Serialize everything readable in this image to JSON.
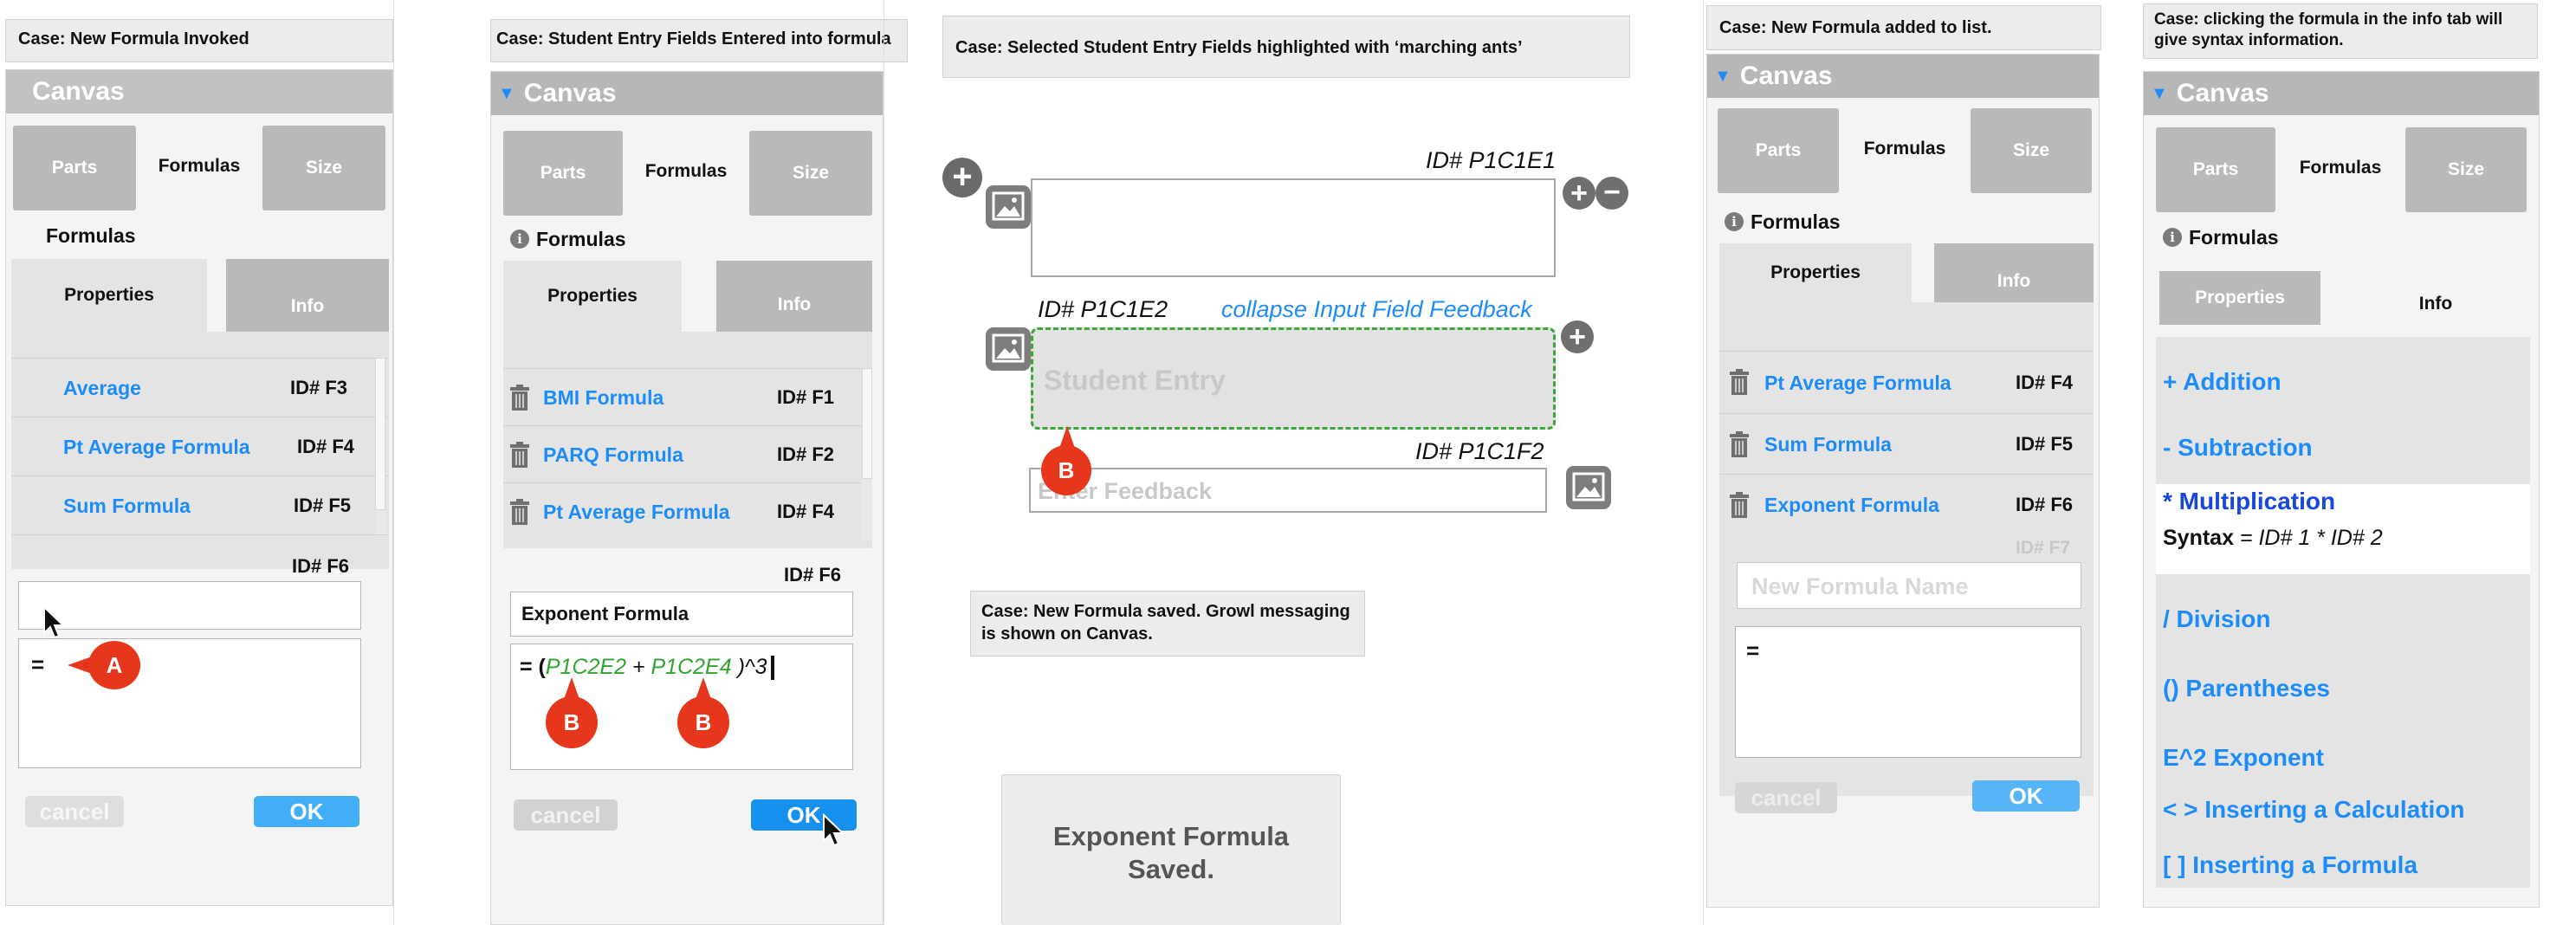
{
  "panel1": {
    "case": "Case: New Formula Invoked",
    "title": "Canvas",
    "tabs": [
      "Parts",
      "Formulas",
      "Size"
    ],
    "section": "Formulas",
    "subtabs": [
      "Properties",
      "Info"
    ],
    "rows": [
      {
        "name": "Average",
        "id": "ID# F3"
      },
      {
        "name": "Pt Average Formula",
        "id": "ID# F4"
      },
      {
        "name": "Sum Formula",
        "id": "ID# F5"
      }
    ],
    "extra_id": "ID# F6",
    "equals": "=",
    "marker": "A",
    "cancel": "cancel",
    "ok": "OK"
  },
  "panel2": {
    "case": "Case: Student Entry Fields Entered into formula",
    "title": "Canvas",
    "tabs": [
      "Parts",
      "Formulas",
      "Size"
    ],
    "section": "Formulas",
    "subtabs": [
      "Properties",
      "Info"
    ],
    "rows": [
      {
        "name": "BMI Formula",
        "id": "ID# F1"
      },
      {
        "name": "PARQ Formula",
        "id": "ID# F2"
      },
      {
        "name": "Pt Average Formula",
        "id": "ID# F4"
      }
    ],
    "extra_id": "ID# F6",
    "name_value": "Exponent Formula",
    "formula_prefix": "= (",
    "ref1": "P1C2E2",
    "plus": " + ",
    "ref2": "P1C2E4",
    "formula_suffix": " )^3",
    "marker": "B",
    "cancel": "cancel",
    "ok": "OK"
  },
  "canvas": {
    "case": "Case: Selected Student Entry Fields highlighted with ‘marching ants’",
    "id1": "ID# P1C1E1",
    "id2": "ID# P1C1E2",
    "collapse": "collapse Input Field Feedback",
    "student_entry": "Student Entry",
    "id3": "ID# P1C1F2",
    "feedback_placeholder": "Enter Feedback",
    "marker": "B",
    "case2": "Case: New Formula saved. Growl messaging is shown on Canvas.",
    "growl": "Exponent Formula Saved."
  },
  "panel3": {
    "case": "Case: New Formula added to list.",
    "title": "Canvas",
    "tabs": [
      "Parts",
      "Formulas",
      "Size"
    ],
    "section": "Formulas",
    "subtabs": [
      "Properties",
      "Info"
    ],
    "rows": [
      {
        "name": "Pt Average Formula",
        "id": "ID# F4"
      },
      {
        "name": "Sum Formula",
        "id": "ID# F5"
      },
      {
        "name": "Exponent Formula",
        "id": "ID# F6"
      }
    ],
    "ghost_id": "ID# F7",
    "name_placeholder": "New Formula Name",
    "equals": "=",
    "cancel": "cancel",
    "ok": "OK"
  },
  "panel4": {
    "case": "Case: clicking the formula in the info tab will give syntax information.",
    "title": "Canvas",
    "tabs": [
      "Parts",
      "Formulas",
      "Size"
    ],
    "section": "Formulas",
    "subtabs": [
      "Properties",
      "Info"
    ],
    "items": {
      "addition": "+ Addition",
      "subtraction": "- Subtraction",
      "multiplication": "* Multiplication",
      "syntax_label": "Syntax",
      "syntax_value": " = ID# 1 * ID# 2",
      "division": "/ Division",
      "parentheses": "() Parentheses",
      "exponent": "E^2 Exponent",
      "calculation": "< > Inserting a Calculation",
      "formula": "[ ] Inserting a Formula"
    }
  },
  "colors": {
    "accent": "#1d8cf8",
    "marker": "#e6361c",
    "selection": "#3aa63a"
  }
}
